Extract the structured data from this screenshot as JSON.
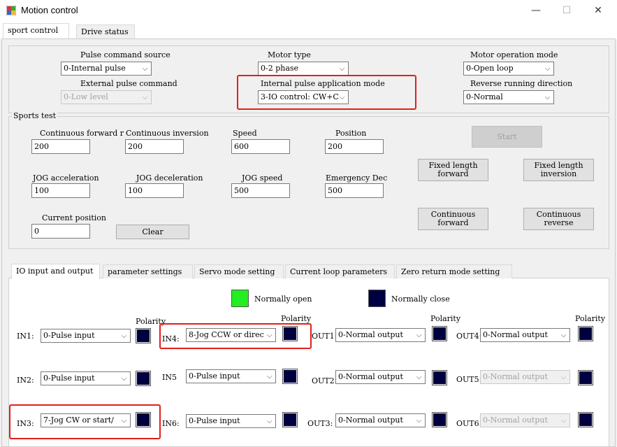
{
  "window": {
    "title": "Motion control",
    "minimize_glyph": "—",
    "maximize_glyph": "☐",
    "close_glyph": "✕"
  },
  "main_tabs": [
    {
      "label": "sport control",
      "active": true
    },
    {
      "label": "Drive status",
      "active": false
    }
  ],
  "settings": {
    "pulse_command_source": {
      "label": "Pulse command source",
      "value": "0-Internal pulse"
    },
    "motor_type": {
      "label": "Motor type",
      "value": "0-2 phase"
    },
    "motor_operation_mode": {
      "label": "Motor operation mode",
      "value": "0-Open loop"
    },
    "external_pulse_command": {
      "label": "External pulse command",
      "value": "0-Low level"
    },
    "internal_pulse_mode": {
      "label": "Internal pulse application mode",
      "value": "3-IO control: CW+C"
    },
    "reverse_running_direction": {
      "label": "Reverse running direction",
      "value": "0-Normal"
    }
  },
  "sports_test": {
    "title": "Sports test",
    "continuous_forward": {
      "label": "Continuous forward r",
      "value": "200"
    },
    "continuous_inversion": {
      "label": "Continuous inversion",
      "value": "200"
    },
    "speed": {
      "label": "Speed",
      "value": "600"
    },
    "position": {
      "label": "Position",
      "value": "200"
    },
    "jog_acceleration": {
      "label": "JOG acceleration",
      "value": "100"
    },
    "jog_deceleration": {
      "label": "JOG deceleration",
      "value": "100"
    },
    "jog_speed": {
      "label": "JOG speed",
      "value": "500"
    },
    "emergency_dec": {
      "label": "Emergency Dec",
      "value": "500"
    },
    "current_position": {
      "label": "Current position",
      "value": "0"
    },
    "clear_label": "Clear",
    "start_label": "Start",
    "fixed_length_forward_label": "Fixed length\nforward",
    "fixed_length_inversion_label": "Fixed length\ninversion",
    "continuous_forward_btn_label": "Continuous\nforward",
    "continuous_reverse_btn_label": "Continuous\nreverse"
  },
  "io_tabs": [
    {
      "label": "IO input and output",
      "active": true
    },
    {
      "label": "parameter settings",
      "active": false
    },
    {
      "label": "Servo mode setting",
      "active": false
    },
    {
      "label": "Current loop parameters",
      "active": false
    },
    {
      "label": "Zero return mode setting",
      "active": false
    }
  ],
  "legend": {
    "normally_open": "Normally open",
    "normally_close": "Normally close",
    "open_color": "#22ee22",
    "close_color": "#000040"
  },
  "io": {
    "polarity_label": "Polarity",
    "in1": {
      "label": "IN1:",
      "value": "0-Pulse input"
    },
    "in2": {
      "label": "IN2:",
      "value": "0-Pulse input"
    },
    "in3": {
      "label": "IN3:",
      "value": "7-Jog CW or start/"
    },
    "in4": {
      "label": "IN4:",
      "value": "8-Jog CCW or direc"
    },
    "in5": {
      "label": "IN5",
      "value": "0-Pulse input"
    },
    "in6": {
      "label": "IN6:",
      "value": "0-Pulse input"
    },
    "out1": {
      "label": "OUT1:",
      "value": "0-Normal output"
    },
    "out2": {
      "label": "OUT2:",
      "value": "0-Normal output"
    },
    "out3": {
      "label": "OUT3:",
      "value": "0-Normal output"
    },
    "out4": {
      "label": "OUT4:",
      "value": "0-Normal output"
    },
    "out5": {
      "label": "OUT5:",
      "value": "0-Normal output"
    },
    "out6": {
      "label": "OUT6:",
      "value": "0-Normal output"
    }
  },
  "colors": {
    "highlight": "#e0201a",
    "polarity_square": "#000040"
  }
}
